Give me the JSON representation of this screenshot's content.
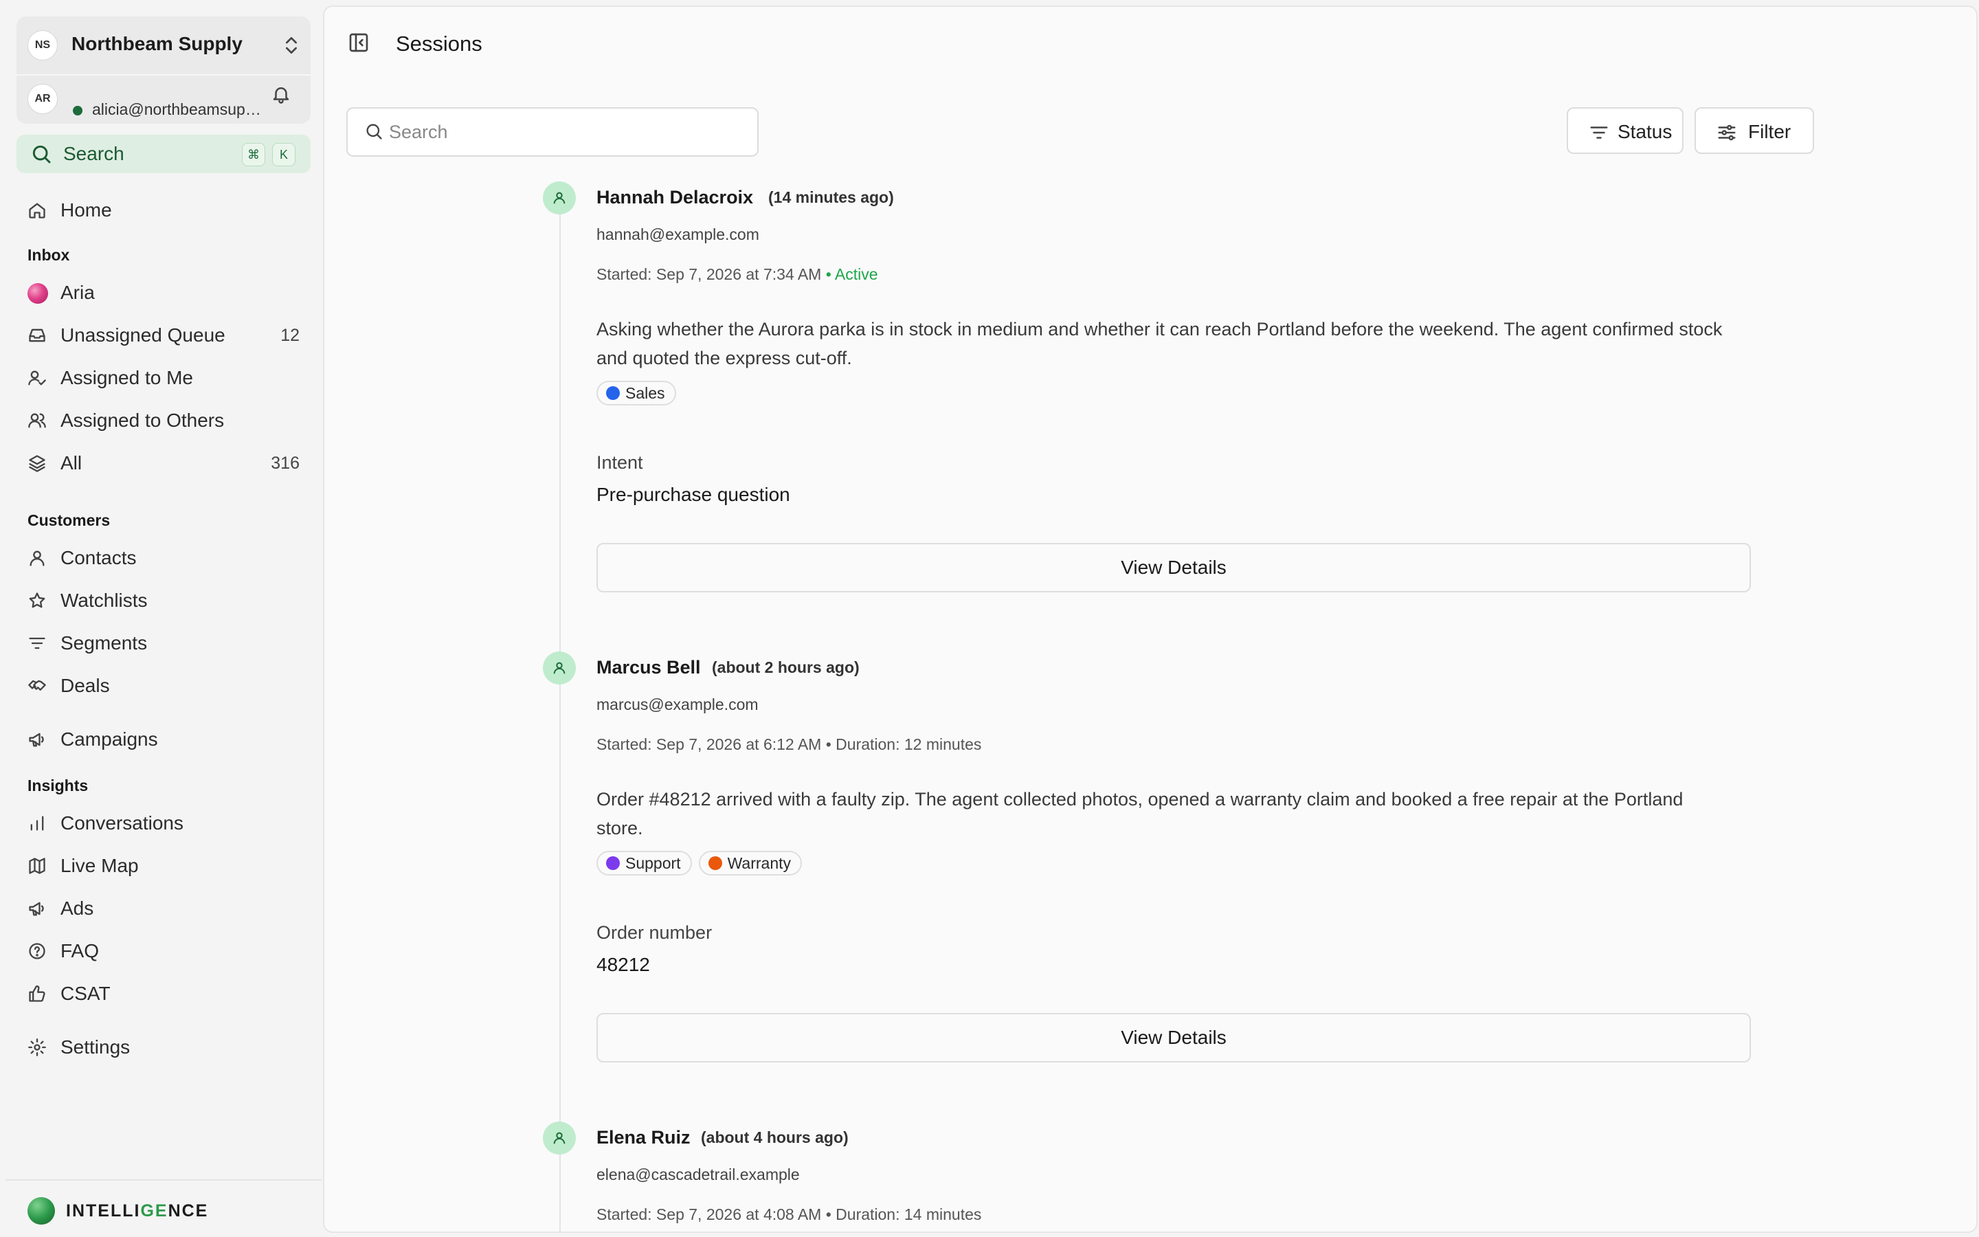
{
  "org": {
    "initials": "NS",
    "name": "Northbeam Supply",
    "user_initials": "AR",
    "user_email": "alicia@northbeamsupply.example"
  },
  "sidebar": {
    "search_label": "Search",
    "search_shortcut": [
      "⌘",
      "K"
    ],
    "home": "Home",
    "inbox_heading": "Inbox",
    "inbox_items": [
      {
        "label": "Aria",
        "count": ""
      },
      {
        "label": "Unassigned Queue",
        "count": "12"
      },
      {
        "label": "Assigned to Me",
        "count": ""
      },
      {
        "label": "Assigned to Others",
        "count": ""
      },
      {
        "label": "All",
        "count": "316"
      }
    ],
    "customers_heading": "Customers",
    "customer_items": [
      "Contacts",
      "Watchlists",
      "Segments",
      "Deals"
    ],
    "campaigns": "Campaigns",
    "insights_heading": "Insights",
    "insight_items": [
      "Conversations",
      "Live Map",
      "Ads",
      "FAQ",
      "CSAT"
    ],
    "settings": "Settings",
    "brand_a": "INTELLI",
    "brand_b": "GE",
    "brand_c": "NCE"
  },
  "main": {
    "title": "Sessions",
    "search_placeholder": "Search",
    "status_label": "Status",
    "filter_label": "Filter"
  },
  "colors": {
    "accent_green": "#1fa64a",
    "tag_sales": "#2563eb",
    "tag_support": "#7c3aed",
    "tag_warranty": "#ea580c"
  },
  "sessions": [
    {
      "name": "Hannah Delacroix",
      "ago": "(14 minutes ago)",
      "email": "hannah@example.com",
      "meta": "Started: Sep 7, 2026 at 7:34 AM",
      "status": "• Active",
      "summary": "Asking whether the Aurora parka is in stock in medium and whether it can reach Portland before the weekend. The agent confirmed stock and quoted the express cut-off.",
      "tags": [
        "Sales"
      ],
      "field_label": "Intent",
      "field_value": "Pre-purchase question",
      "button": "View Details"
    },
    {
      "name": "Marcus Bell",
      "ago": "(about 2 hours ago)",
      "email": "marcus@example.com",
      "meta": "Started: Sep 7, 2026 at 6:12 AM • Duration: 12 minutes",
      "status": "",
      "summary": "Order #48212 arrived with a faulty zip. The agent collected photos, opened a warranty claim and booked a free repair at the Portland store.",
      "tags": [
        "Support",
        "Warranty"
      ],
      "field_label": "Order number",
      "field_value": "48212",
      "button": "View Details"
    },
    {
      "name": "Elena Ruiz",
      "ago": "(about 4 hours ago)",
      "email": "elena@cascadetrail.example",
      "meta": "Started: Sep 7, 2026 at 4:08 AM • Duration: 14 minutes",
      "status": ""
    }
  ]
}
